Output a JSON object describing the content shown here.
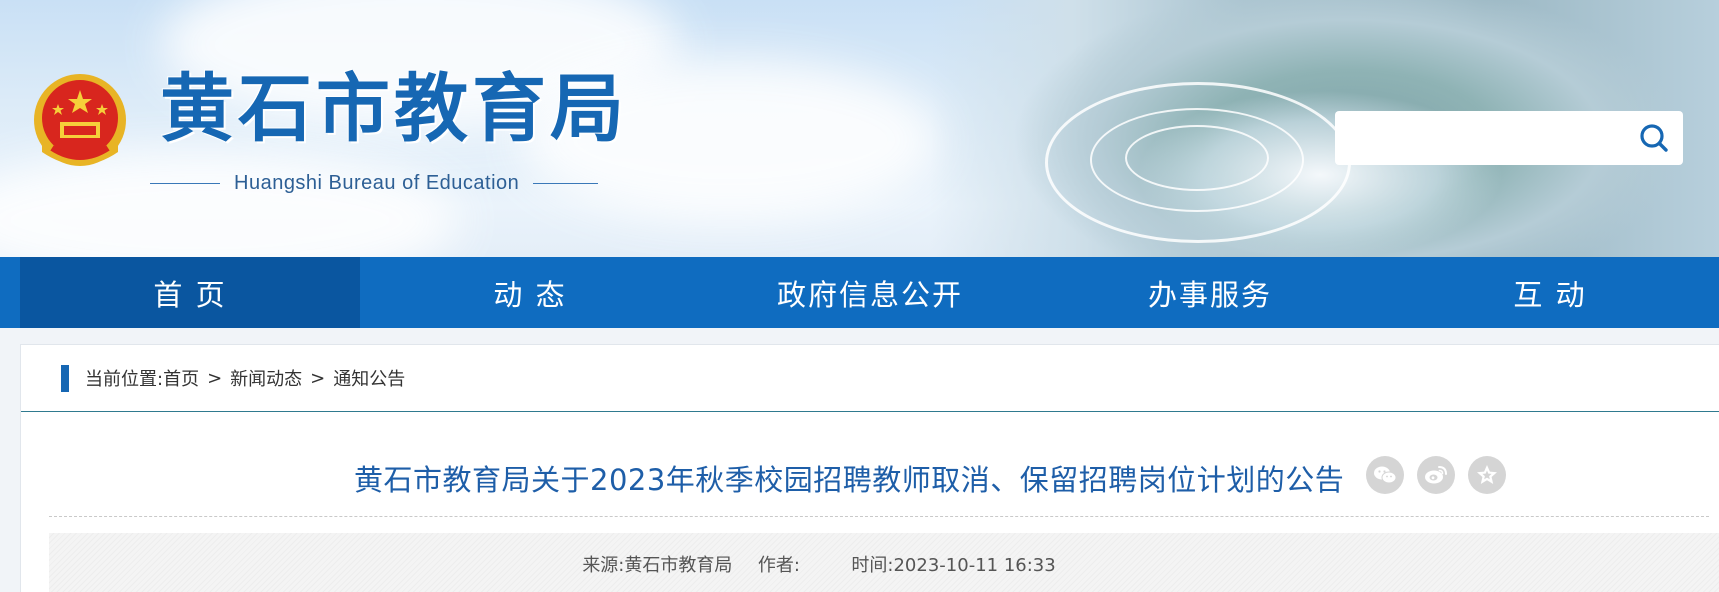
{
  "header": {
    "title": "黄石市教育局",
    "subtitle": "Huangshi Bureau of Education",
    "search": {
      "placeholder": ""
    }
  },
  "nav": {
    "items": [
      {
        "label": "首 页",
        "active": true
      },
      {
        "label": "动 态",
        "active": false
      },
      {
        "label": "政府信息公开",
        "active": false
      },
      {
        "label": "办事服务",
        "active": false
      },
      {
        "label": "互 动",
        "active": false
      }
    ]
  },
  "breadcrumb": {
    "prefix": "当前位置:",
    "items": [
      "首页",
      "新闻动态",
      "通知公告"
    ],
    "separator": ">"
  },
  "article": {
    "title": "黄石市教育局关于2023年秋季校园招聘教师取消、保留招聘岗位计划的公告",
    "meta": {
      "source_label": "来源:",
      "source": "黄石市教育局",
      "author_label": "作者:",
      "author": "",
      "time_label": "时间:",
      "time": "2023-10-11 16:33"
    },
    "share": [
      "wechat-icon",
      "weibo-icon",
      "favorite-star-icon"
    ]
  },
  "colors": {
    "brand_blue": "#1667b3",
    "nav_blue": "#0f6cc0",
    "nav_active": "#0a56a0",
    "title_blue": "#1e5ea8"
  }
}
